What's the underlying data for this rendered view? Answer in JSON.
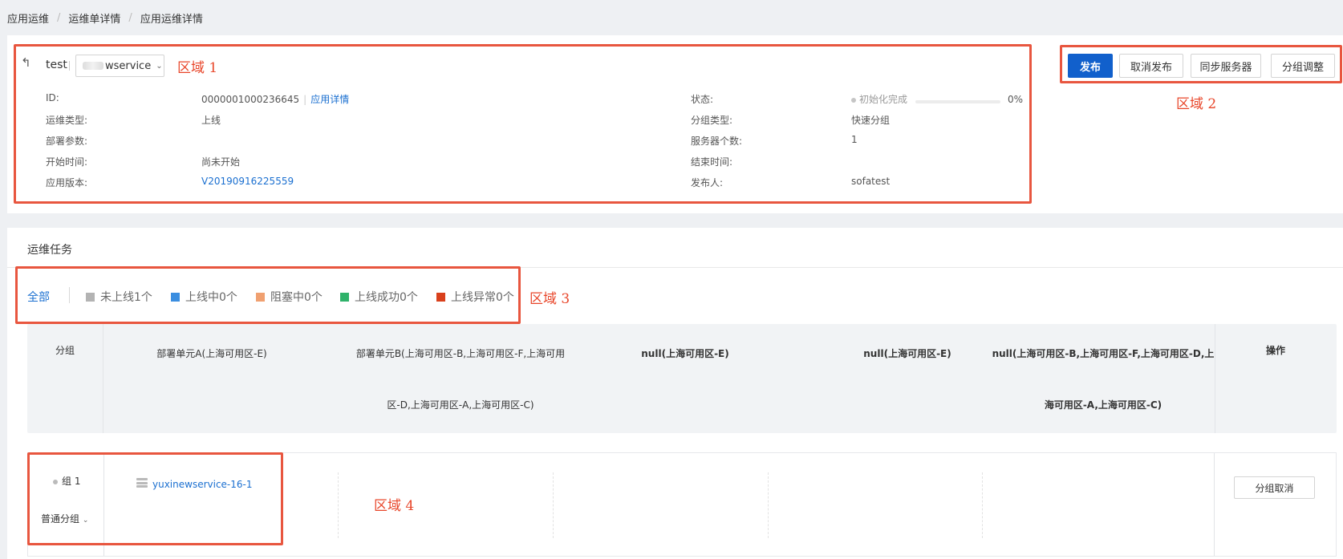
{
  "breadcrumb": [
    "应用运维",
    "运维单详情",
    "应用运维详情"
  ],
  "header": {
    "app_name": "test",
    "service_suffix": "wservice",
    "region_label": "区域 1"
  },
  "info": {
    "left": [
      {
        "label": "ID:",
        "value": "0000001000236645",
        "link": "应用详情"
      },
      {
        "label": "运维类型:",
        "value": "上线"
      },
      {
        "label": "部署参数:",
        "value": ""
      },
      {
        "label": "开始时间:",
        "value": "尚未开始"
      },
      {
        "label": "应用版本:",
        "value": "V20190916225559"
      }
    ],
    "right": [
      {
        "label": "状态:",
        "value": "初始化完成",
        "progress_text": "0%"
      },
      {
        "label": "分组类型:",
        "value": "快速分组"
      },
      {
        "label": "服务器个数:",
        "value": "1"
      },
      {
        "label": "结束时间:",
        "value": ""
      },
      {
        "label": "发布人:",
        "value": "sofatest"
      }
    ],
    "progress_fraction": 0
  },
  "actions": {
    "publish": "发布",
    "cancel_publish": "取消发布",
    "sync_servers": "同步服务器",
    "group_adjust": "分组调整",
    "region_label": "区域 2"
  },
  "task": {
    "title": "运维任务",
    "filters": [
      {
        "label": "全部",
        "color": ""
      },
      {
        "label": "未上线1个",
        "color": "#b3b3b3"
      },
      {
        "label": "上线中0个",
        "color": "#3b8ee0"
      },
      {
        "label": "阻塞中0个",
        "color": "#f0a070"
      },
      {
        "label": "上线成功0个",
        "color": "#2fb26a"
      },
      {
        "label": "上线异常0个",
        "color": "#d9401c"
      }
    ],
    "region_label": "区域 3"
  },
  "table": {
    "col_group": "分组",
    "col_op": "操作",
    "cols": [
      {
        "line1": "部署单元A(上海可用区-E)",
        "line2": ""
      },
      {
        "line1": "部署单元B(上海可用区-B,上海可用区-F,上海可用",
        "line2": "区-D,上海可用区-A,上海可用区-C)"
      },
      {
        "line1": "null(上海可用区-E)",
        "line2": ""
      },
      {
        "line1": "null(上海可用区-E)",
        "line2": ""
      },
      {
        "line1": "null(上海可用区-B,上海可用区-F,上海可用区-D,上",
        "line2": "海可用区-A,上海可用区-C)"
      }
    ],
    "row": {
      "group_name": "组 1",
      "group_type": "普通分组",
      "server": "yuxinewservice-16-1",
      "cancel_btn": "分组取消"
    },
    "region_label": "区域 4"
  }
}
